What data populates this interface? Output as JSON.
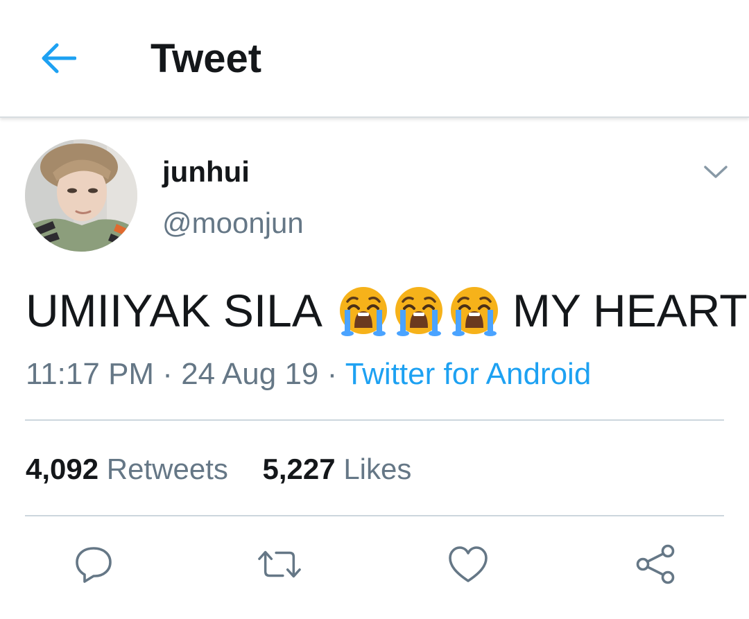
{
  "header": {
    "title": "Tweet",
    "back_icon": "arrow-left-icon"
  },
  "tweet": {
    "display_name": "junhui",
    "handle": "@moonjun",
    "text_before": "UMIIYAK SILA",
    "emojis": [
      "😭",
      "😭",
      "😭"
    ],
    "text_after": "MY HEART",
    "time": "11:17 PM",
    "separator": " · ",
    "date": "24 Aug 19",
    "source": "Twitter for Android"
  },
  "stats": {
    "retweets_count": "4,092",
    "retweets_label": "Retweets",
    "likes_count": "5,227",
    "likes_label": "Likes"
  },
  "actions": [
    "reply-icon",
    "retweet-icon",
    "like-icon",
    "share-icon"
  ],
  "colors": {
    "accent": "#1da1f2",
    "text": "#14171a",
    "secondary": "#657786",
    "divider": "#ccd6dd",
    "icon": "#657786"
  }
}
